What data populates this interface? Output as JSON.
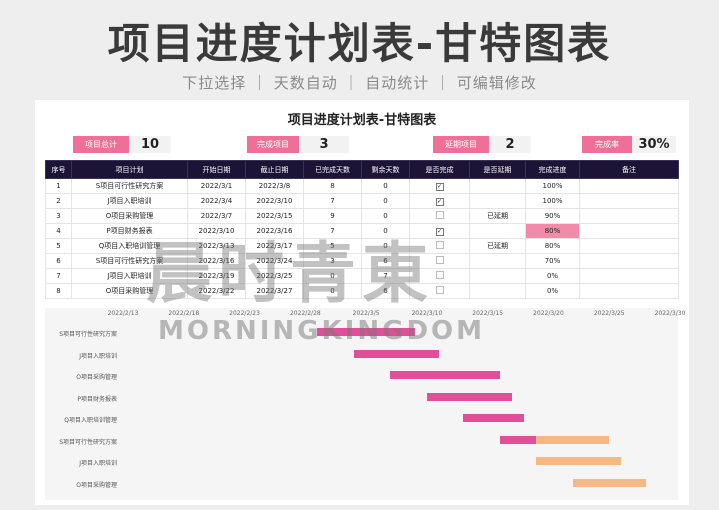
{
  "hero": {
    "title": "项目进度计划表-甘特图表",
    "subtitle": "下拉选择 ｜ 天数自动 ｜ 自动统计 ｜ 可编辑修改"
  },
  "sheet": {
    "title": "项目进度计划表-甘特图表",
    "stats": [
      {
        "label": "项目总计",
        "value": "10",
        "color": "#f06f97"
      },
      {
        "label": "完成项目",
        "value": "3",
        "color": "#f06f97"
      },
      {
        "label": "延期项目",
        "value": "2",
        "color": "#f06f97"
      },
      {
        "label": "完成率",
        "value": "30%",
        "color": "#f06f97"
      }
    ],
    "columns": [
      "序号",
      "项目计划",
      "开始日期",
      "截止日期",
      "已完成天数",
      "剩余天数",
      "是否完成",
      "是否延期",
      "完成进度",
      "备注"
    ],
    "rows": [
      {
        "no": "1",
        "plan": "S项目可行性研究方案",
        "start": "2022/3/1",
        "end": "2022/3/8",
        "done": "8",
        "left": "0",
        "complete": true,
        "delay": "",
        "progress": "100%",
        "note": ""
      },
      {
        "no": "2",
        "plan": "J项目入职培训",
        "start": "2022/3/4",
        "end": "2022/3/10",
        "done": "7",
        "left": "0",
        "complete": true,
        "delay": "",
        "progress": "100%",
        "note": ""
      },
      {
        "no": "3",
        "plan": "O项目采购管理",
        "start": "2022/3/7",
        "end": "2022/3/15",
        "done": "9",
        "left": "0",
        "complete": false,
        "delay": "已延期",
        "progress": "90%",
        "note": ""
      },
      {
        "no": "4",
        "plan": "P项目财务报表",
        "start": "2022/3/10",
        "end": "2022/3/16",
        "done": "7",
        "left": "0",
        "complete": true,
        "delay": "",
        "progress": "80%",
        "note": ""
      },
      {
        "no": "5",
        "plan": "Q项目入职培训管理",
        "start": "2022/3/13",
        "end": "2022/3/17",
        "done": "5",
        "left": "0",
        "complete": false,
        "delay": "已延期",
        "progress": "80%",
        "note": ""
      },
      {
        "no": "6",
        "plan": "S项目可行性研究方案",
        "start": "2022/3/16",
        "end": "2022/3/24",
        "done": "3",
        "left": "6",
        "complete": false,
        "delay": "",
        "progress": "70%",
        "note": ""
      },
      {
        "no": "7",
        "plan": "J项目入职培训",
        "start": "2022/3/19",
        "end": "2022/3/25",
        "done": "0",
        "left": "7",
        "complete": false,
        "delay": "",
        "progress": "0%",
        "note": ""
      },
      {
        "no": "8",
        "plan": "O项目采购管理",
        "start": "2022/3/22",
        "end": "2022/3/27",
        "done": "0",
        "left": "6",
        "complete": false,
        "delay": "",
        "progress": "0%",
        "note": ""
      }
    ]
  },
  "gantt": {
    "ticks": [
      "2022/2/13",
      "2022/2/18",
      "2022/2/23",
      "2022/2/28",
      "2022/3/5",
      "2022/3/10",
      "2022/3/15",
      "2022/3/20",
      "2022/3/25",
      "2022/3/30"
    ],
    "colors": {
      "done": "#e24f98",
      "remaining": "#f5b884"
    }
  },
  "watermark": {
    "cn": "晨时青東",
    "en": "MORNINGKINGDOM"
  }
}
